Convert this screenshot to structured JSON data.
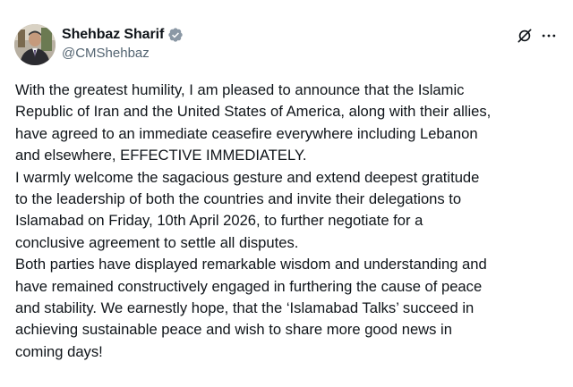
{
  "author": {
    "display_name": "Shehbaz Sharif",
    "handle": "@CMShehbaz",
    "verified": true,
    "verified_color": "#8b98a5"
  },
  "icons": {
    "grok": "grok-slash-icon",
    "more": "more-horizontal-icon",
    "verified": "verified-badge-icon"
  },
  "tweet": {
    "paragraphs": [
      "With the greatest humility, I am pleased to announce that the Islamic\nRepublic of Iran and the United States of America, along with their allies,\nhave agreed to an immediate ceasefire everywhere including Lebanon\nand elsewhere, EFFECTIVE IMMEDIATELY.",
      "I warmly welcome the sagacious gesture and extend deepest gratitude\nto the leadership of both the countries and invite their delegations to\nIslamabad on Friday, 10th April 2026, to further negotiate for a\nconclusive agreement to settle all disputes.",
      "Both parties have displayed remarkable wisdom and understanding and\nhave remained constructively engaged in furthering the cause of peace\nand stability. We earnestly hope, that the ‘Islamabad Talks’ succeed in\nachieving sustainable peace and wish to share more good news in\ncoming days!"
    ]
  },
  "colors": {
    "text": "#0f1419",
    "secondary_text": "#536471",
    "background": "#ffffff"
  }
}
